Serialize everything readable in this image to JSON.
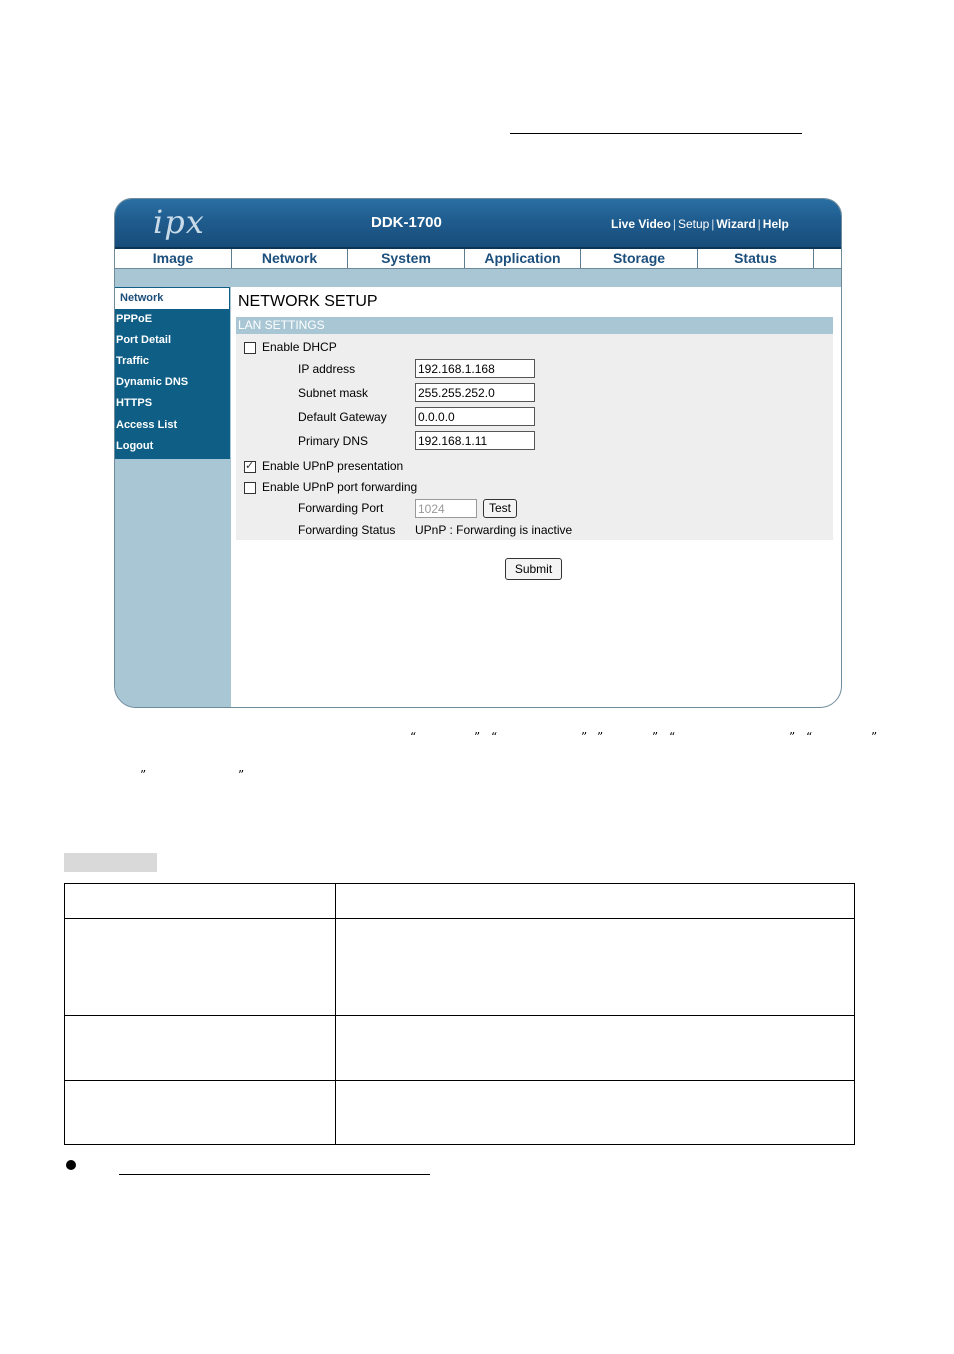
{
  "header": {
    "brand": "ipx",
    "model": "DDK-1700",
    "links": [
      {
        "label": "Live Video",
        "bold": true
      },
      {
        "label": "Setup",
        "bold": false
      },
      {
        "label": "Wizard",
        "bold": true
      },
      {
        "label": "Help",
        "bold": true
      }
    ],
    "separator": "|"
  },
  "nav": {
    "tabs": [
      "Image",
      "Network",
      "System",
      "Application",
      "Storage",
      "Status"
    ]
  },
  "sidebar": {
    "items": [
      "Network",
      "PPPoE",
      "Port Detail",
      "Traffic",
      "Dynamic DNS",
      "HTTPS",
      "Access List",
      "Logout"
    ],
    "active_index": 0
  },
  "main": {
    "heading": "NETWORK SETUP",
    "section": "LAN SETTINGS",
    "enable_dhcp": {
      "label": "Enable DHCP",
      "checked": false
    },
    "ip_address": {
      "label": "IP address",
      "value": "192.168.1.168"
    },
    "subnet_mask": {
      "label": "Subnet mask",
      "value": "255.255.252.0"
    },
    "default_gateway": {
      "label": "Default Gateway",
      "value": "0.0.0.0"
    },
    "primary_dns": {
      "label": "Primary DNS",
      "value": "192.168.1.11"
    },
    "upnp_presentation": {
      "label": "Enable UPnP presentation",
      "checked": true
    },
    "upnp_forwarding": {
      "label": "Enable UPnP port forwarding",
      "checked": false
    },
    "forwarding_port": {
      "label": "Forwarding Port",
      "value": "1024"
    },
    "test_label": "Test",
    "forwarding_status": {
      "label": "Forwarding Status",
      "value": "UPnP : Forwarding is inactive"
    },
    "submit_label": "Submit"
  },
  "doc": {
    "quotes_line1": [
      "“",
      "”",
      "“",
      "”",
      "”",
      "”",
      "“",
      "”",
      "“",
      "”"
    ],
    "quotes_line2": [
      "”",
      "”"
    ],
    "bullet": "●"
  },
  "colors": {
    "header_blue": "#1f5c8e",
    "sidebar_blue": "#0e5e86",
    "light_blue": "#a8c6d4",
    "tab_text": "#1c4f7c"
  }
}
